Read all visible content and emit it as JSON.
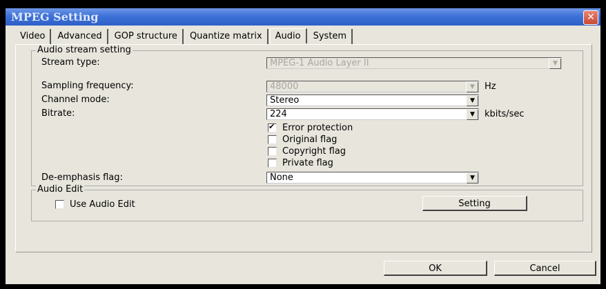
{
  "window": {
    "title": "MPEG Setting",
    "close_glyph": "✕"
  },
  "tabs": [
    {
      "label": "Video"
    },
    {
      "label": "Advanced"
    },
    {
      "label": "GOP structure"
    },
    {
      "label": "Quantize matrix"
    },
    {
      "label": "Audio",
      "active": true
    },
    {
      "label": "System"
    }
  ],
  "audio_stream": {
    "group_title": "Audio stream setting",
    "stream_type": {
      "label": "Stream type:",
      "value": "MPEG-1 Audio Layer II",
      "enabled": false
    },
    "sampling_frequency": {
      "label": "Sampling frequency:",
      "value": "48000",
      "unit": "Hz",
      "enabled": false
    },
    "channel_mode": {
      "label": "Channel mode:",
      "value": "Stereo"
    },
    "bitrate": {
      "label": "Bitrate:",
      "value": "224",
      "unit": "kbits/sec"
    },
    "flags": [
      {
        "label": "Error protection",
        "checked": true
      },
      {
        "label": "Original flag",
        "checked": false
      },
      {
        "label": "Copyright flag",
        "checked": false
      },
      {
        "label": "Private flag",
        "checked": false
      }
    ],
    "de_emphasis": {
      "label": "De-emphasis flag:",
      "value": "None"
    }
  },
  "audio_edit": {
    "group_title": "Audio Edit",
    "use_label": "Use Audio Edit",
    "use_checked": false,
    "setting_button": "Setting"
  },
  "buttons": {
    "ok": "OK",
    "cancel": "Cancel"
  },
  "icons": {
    "dropdown_arrow": "▼"
  }
}
